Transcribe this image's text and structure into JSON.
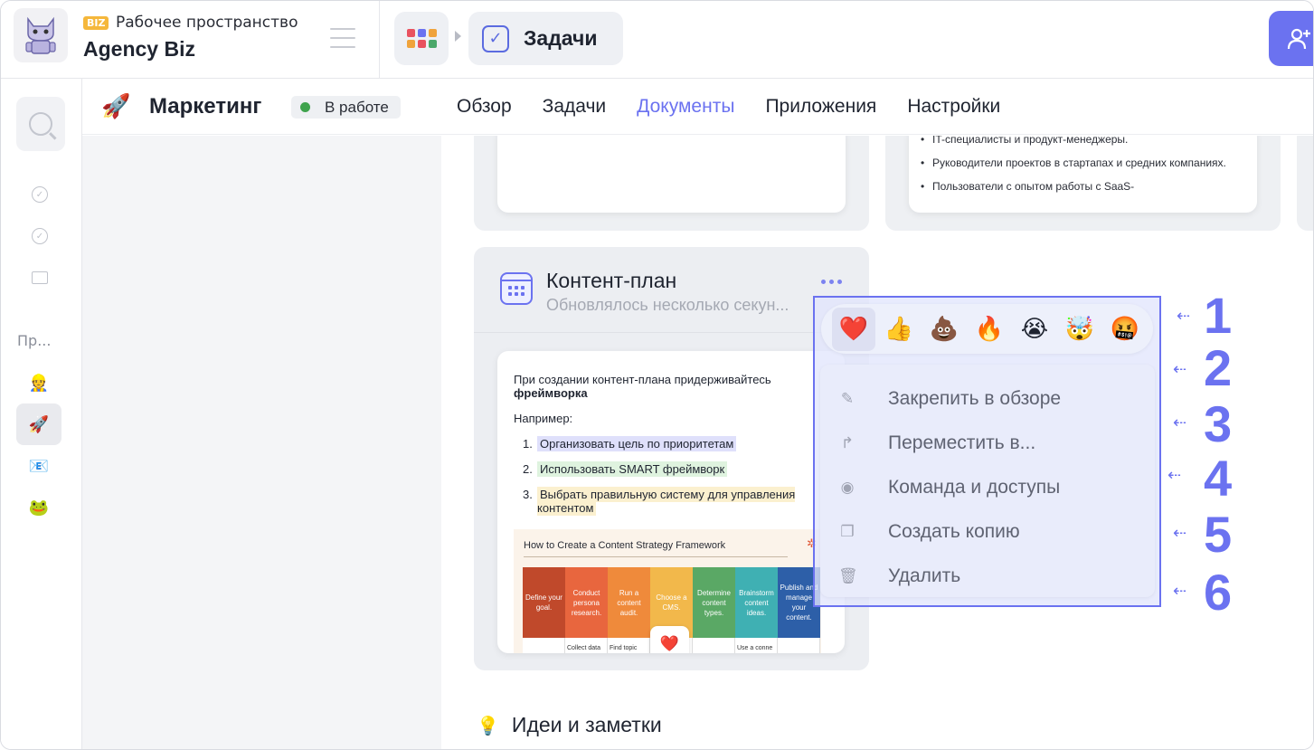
{
  "workspace": {
    "badge": "BIZ",
    "subtitle": "Рабочее пространство",
    "title": "Agency Biz",
    "logo_icon": "cat-robot-logo"
  },
  "breadcrumb": {
    "apps_icon": "apps-grid-icon",
    "current": "Задачи"
  },
  "invite_button_icon": "add-user-icon",
  "sidebar": {
    "section_label": "Пр...",
    "projects": [
      {
        "icon": "👷"
      },
      {
        "icon": "🚀",
        "active": true
      },
      {
        "icon": "📧"
      },
      {
        "icon": "🐸"
      }
    ]
  },
  "project": {
    "icon": "🚀",
    "title": "Маркетинг",
    "status": "В работе",
    "status_color": "#3fa34d"
  },
  "nav": {
    "items": [
      "Обзор",
      "Задачи",
      "Документы",
      "Приложения",
      "Настройки"
    ],
    "active_index": 2
  },
  "doc_card_b": {
    "bullets": [
      "IT-специалисты и продукт-менеджеры.",
      "Руководители проектов в стартапах и средних компаниях.",
      "Пользователи с опытом работы с SaaS-"
    ]
  },
  "plan_card": {
    "title": "Контент-план",
    "subtitle": "Обновлялось несколько секун...",
    "doc": {
      "intro": "При создании контент-плана придерживайтесь",
      "intro_bold": "фреймворка",
      "example_label": "Например:",
      "list": [
        "Организовать цель по приоритетам",
        "Использовать SMART фреймворк",
        "Выбрать правильную систему для управления контентом"
      ],
      "image": {
        "title": "How to Create a Content Strategy Framework",
        "columns": [
          {
            "label": "Define your goal.",
            "color": "#c0492b"
          },
          {
            "label": "Conduct persona research.",
            "color": "#e8663e"
          },
          {
            "label": "Run a content audit.",
            "color": "#ef8a3b"
          },
          {
            "label": "Choose a CMS.",
            "color": "#f2b84b"
          },
          {
            "label": "Determine content types.",
            "color": "#5aa865"
          },
          {
            "label": "Brainstorm content ideas.",
            "color": "#3fb0b3"
          },
          {
            "label": "Publish and manage your content.",
            "color": "#2d5fa8"
          }
        ],
        "cells": [
          "",
          "Collect data",
          "Find topic",
          "",
          "",
          "Use a conne",
          ""
        ]
      },
      "reaction": "❤️"
    }
  },
  "ideas": {
    "icon": "💡",
    "title": "Идеи и заметки"
  },
  "context_menu": {
    "reactions": [
      "❤️",
      "👍",
      "💩",
      "🔥",
      "😭",
      "🤯",
      "🤬"
    ],
    "selected_reaction": 0,
    "items": [
      {
        "icon": "pin-icon",
        "label": "Закрепить в обзоре"
      },
      {
        "icon": "move-arrow-icon",
        "label": "Переместить в..."
      },
      {
        "icon": "eye-icon",
        "label": "Команда и доступы"
      },
      {
        "icon": "copy-icon",
        "label": "Создать копию"
      },
      {
        "icon": "trash-icon",
        "label": "Удалить"
      }
    ]
  },
  "callouts": [
    "1",
    "2",
    "3",
    "4",
    "5",
    "6"
  ],
  "accent_color": "#6b72f0"
}
